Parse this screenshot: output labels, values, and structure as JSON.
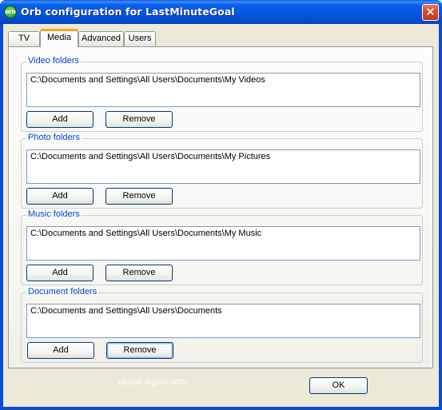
{
  "window": {
    "title": "Orb configuration for LastMinuteGoal",
    "app_icon": "orb-logo-icon",
    "app_icon_text": "orb",
    "close_glyph": "✕"
  },
  "tabs": [
    {
      "label": "TV",
      "active": false
    },
    {
      "label": "Media",
      "active": true
    },
    {
      "label": "Advanced",
      "active": false
    },
    {
      "label": "Users",
      "active": false
    }
  ],
  "groups": [
    {
      "label": "Video folders",
      "items": [
        "C:\\Documents and Settings\\All Users\\Documents\\My Videos"
      ],
      "add_label": "Add",
      "remove_label": "Remove"
    },
    {
      "label": "Photo folders",
      "items": [
        "C:\\Documents and Settings\\All Users\\Documents\\My Pictures"
      ],
      "add_label": "Add",
      "remove_label": "Remove"
    },
    {
      "label": "Music folders",
      "items": [
        "C:\\Documents and Settings\\All Users\\Documents\\My Music"
      ],
      "add_label": "Add",
      "remove_label": "Remove"
    },
    {
      "label": "Document folders",
      "items": [
        "C:\\Documents and Settings\\All Users\\Documents"
      ],
      "add_label": "Add",
      "remove_label": "Remove"
    }
  ],
  "footer": {
    "ok_label": "OK",
    "watermark": "digital-digest.com"
  }
}
